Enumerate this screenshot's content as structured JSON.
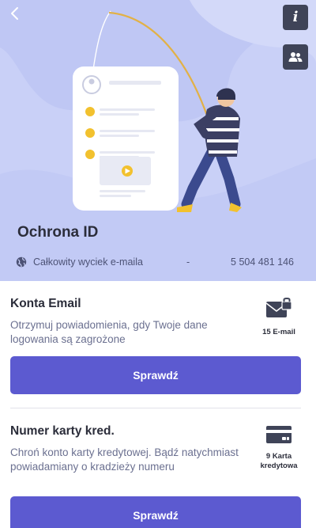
{
  "hero": {
    "title": "Ochrona ID",
    "breach_label": "Całkowity wyciek e-maila",
    "breach_separator": "-",
    "breach_count": "5 504 481 146",
    "bg_color": "#c9d0f7"
  },
  "top_buttons": {
    "info_symbol": "i",
    "family_icon": "people-icon",
    "back_icon": "chevron-left-icon"
  },
  "sections": [
    {
      "title": "Konta Email",
      "description": "Otrzymuj powiadomienia, gdy Twoje dane logowania są zagrożone",
      "badge_icon": "envelope-lock-icon",
      "badge_caption": "15 E-mail",
      "button_label": "Sprawdź"
    },
    {
      "title": "Numer karty kred.",
      "description": "Chroń konto karty kredytowej. Bądź natychmiast powiadamiany o kradzieży numeru",
      "badge_icon": "credit-card-icon",
      "badge_caption": "9 Karta kredytowa",
      "button_label": "Sprawdź"
    }
  ],
  "colors": {
    "accent": "#5c5ad0",
    "dark_button": "#3f4458",
    "thief_sweater_dark": "#3b3f63",
    "thief_pants": "#3b4a8e",
    "bullet_yellow": "#f2c12e"
  }
}
